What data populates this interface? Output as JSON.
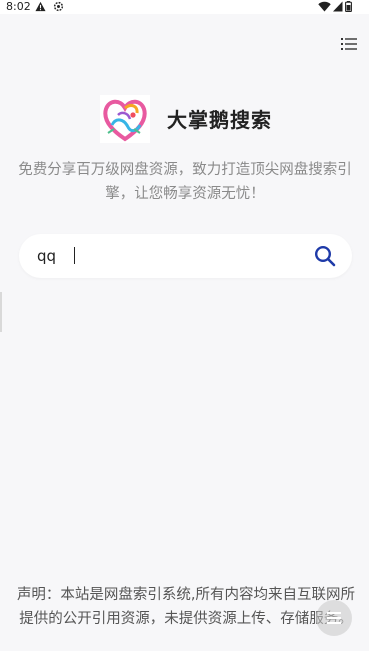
{
  "status_bar": {
    "time": "8:02",
    "icons": [
      "warning-icon",
      "settings-icon",
      "wifi-icon",
      "signal-icon",
      "battery-icon"
    ]
  },
  "header": {
    "menu_icon": "list-menu-icon"
  },
  "brand": {
    "logo_icon": "swan-heart-logo",
    "title": "大掌鹅搜索",
    "tagline": "免费分享百万级网盘资源，致力打造顶尖网盘搜索引擎，让您畅享资源无忧！"
  },
  "search": {
    "value": "qq",
    "placeholder": "",
    "button_icon": "search-icon",
    "accent_color": "#1e3aa8"
  },
  "footer": {
    "disclaimer": "声明：本站是网盘索引系统,所有内容均来自互联网所提供的公开引用资源，未提供资源上传、存储服务。",
    "fab_icon": "menu-icon"
  }
}
